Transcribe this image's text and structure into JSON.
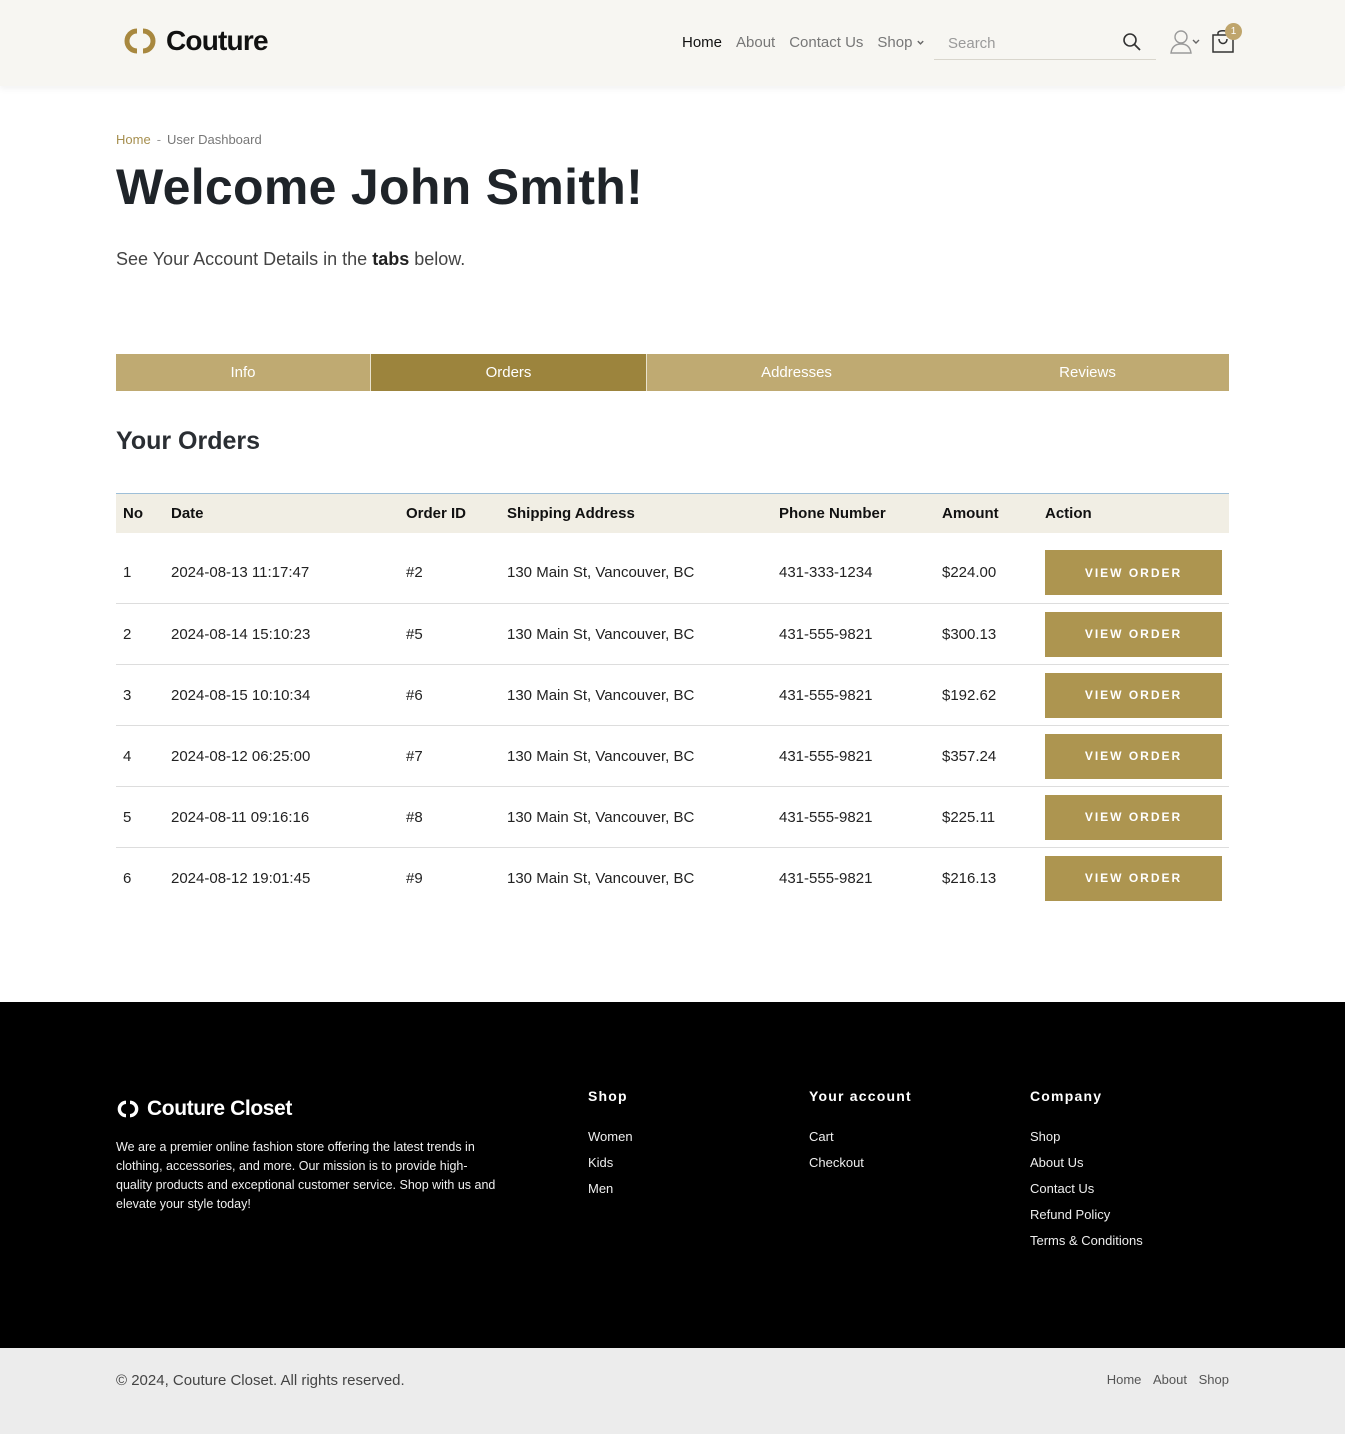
{
  "header": {
    "logo_text": "Couture",
    "nav": {
      "home": "Home",
      "about": "About",
      "contact": "Contact Us",
      "shop": "Shop"
    },
    "search_placeholder": "Search",
    "cart_count": "1"
  },
  "breadcrumb": {
    "home": "Home",
    "separator": "-",
    "current": "User Dashboard"
  },
  "welcome": {
    "title": "Welcome John Smith!",
    "subtitle_pre": "See Your Account Details in the",
    "subtitle_bold": "tabs",
    "subtitle_post": "below."
  },
  "tabs": [
    "Info",
    "Orders",
    "Addresses",
    "Reviews"
  ],
  "orders": {
    "title": "Your Orders",
    "columns": [
      "No",
      "Date",
      "Order ID",
      "Shipping Address",
      "Phone Number",
      "Amount",
      "Action"
    ],
    "button_label": "VIEW ORDER",
    "rows": [
      {
        "no": "1",
        "date": "2024-08-13 11:17:47",
        "order_id": "#2",
        "address": "130 Main St, Vancouver, BC",
        "phone": "431-333-1234",
        "amount": "$224.00"
      },
      {
        "no": "2",
        "date": "2024-08-14 15:10:23",
        "order_id": "#5",
        "address": "130 Main St, Vancouver, BC",
        "phone": "431-555-9821",
        "amount": "$300.13"
      },
      {
        "no": "3",
        "date": "2024-08-15 10:10:34",
        "order_id": "#6",
        "address": "130 Main St, Vancouver, BC",
        "phone": "431-555-9821",
        "amount": "$192.62"
      },
      {
        "no": "4",
        "date": "2024-08-12 06:25:00",
        "order_id": "#7",
        "address": "130 Main St, Vancouver, BC",
        "phone": "431-555-9821",
        "amount": "$357.24"
      },
      {
        "no": "5",
        "date": "2024-08-11 09:16:16",
        "order_id": "#8",
        "address": "130 Main St, Vancouver, BC",
        "phone": "431-555-9821",
        "amount": "$225.11"
      },
      {
        "no": "6",
        "date": "2024-08-12 19:01:45",
        "order_id": "#9",
        "address": "130 Main St, Vancouver, BC",
        "phone": "431-555-9821",
        "amount": "$216.13"
      }
    ]
  },
  "footer": {
    "logo_text": "Couture Closet",
    "about": "We are a premier online fashion store offering the latest trends in clothing, accessories, and more. Our mission is to provide high-quality products and exceptional customer service. Shop with us and elevate your style today!",
    "columns": [
      {
        "title": "Shop",
        "links": [
          "Women",
          "Kids",
          "Men"
        ]
      },
      {
        "title": "Your account",
        "links": [
          "Cart",
          "Checkout"
        ]
      },
      {
        "title": "Company",
        "links": [
          "Shop",
          "About Us",
          "Contact Us",
          "Refund Policy",
          "Terms & Conditions"
        ]
      }
    ],
    "copyright": "© 2024, Couture Closet. All rights reserved.",
    "bottom_links": [
      "Home",
      "About",
      "Shop"
    ]
  },
  "colors": {
    "accent": "#ad9550",
    "tab_bg": "#bfaa72",
    "tab_active": "#9c843d",
    "header_bg": "#f7f6f2",
    "footer_bg": "#000000"
  },
  "icons": [
    "couture-logo-icon",
    "chevron-down-icon",
    "search-icon",
    "user-icon",
    "shopping-bag-icon"
  ]
}
